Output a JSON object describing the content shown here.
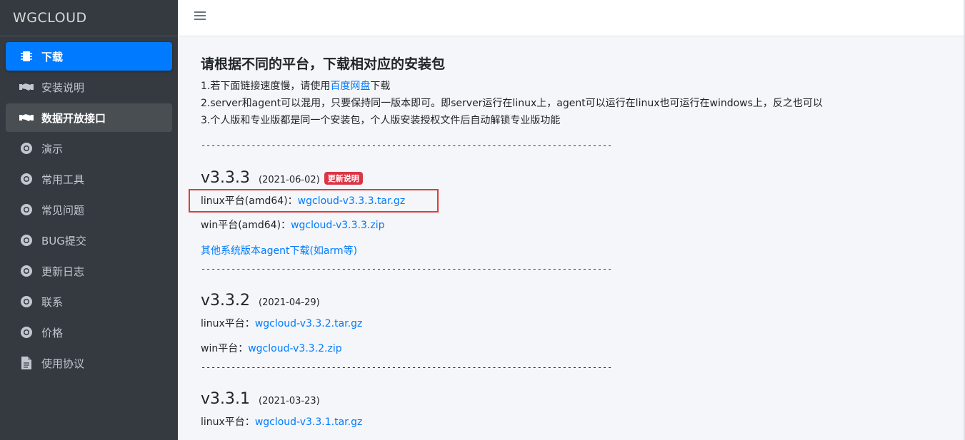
{
  "brand": "WGCLOUD",
  "sidebar": {
    "items": [
      {
        "label": "下载",
        "icon": "microchip-icon"
      },
      {
        "label": "安装说明",
        "icon": "handshake-icon"
      },
      {
        "label": "数据开放接口",
        "icon": "handshake-icon"
      },
      {
        "label": "演示",
        "icon": "chrome-icon"
      },
      {
        "label": "常用工具",
        "icon": "chrome-icon"
      },
      {
        "label": "常见问题",
        "icon": "chrome-icon"
      },
      {
        "label": "BUG提交",
        "icon": "chrome-icon"
      },
      {
        "label": "更新日志",
        "icon": "chrome-icon"
      },
      {
        "label": "联系",
        "icon": "chrome-icon"
      },
      {
        "label": "价格",
        "icon": "chrome-icon"
      },
      {
        "label": "使用协议",
        "icon": "file-icon"
      }
    ]
  },
  "topbar": {
    "menu_icon": "hamburger-icon"
  },
  "content": {
    "title": "请根据不同的平台，下载相对应的安装包",
    "note1_prefix": "1.若下面链接速度慢，请使用",
    "note1_link": "百度网盘",
    "note1_suffix": "下载",
    "note2": "2.server和agent可以混用，只要保持同一版本即可。即server运行在linux上，agent可以运行在linux也可运行在windows上，反之也可以",
    "note3": "3.个人版和专业版都是同一个安装包，个人版安装授权文件后自动解锁专业版功能",
    "separator": "------------------------------------------------------------------------------------------------------------------------------------------------------",
    "releases": [
      {
        "version": "v3.3.3",
        "date": "(2021-06-02)",
        "badge": "更新说明",
        "linux_label": "linux平台(amd64)：",
        "linux_file": "wgcloud-v3.3.3.tar.gz",
        "win_label": "win平台(amd64)：",
        "win_file": "wgcloud-v3.3.3.zip",
        "other_link": "其他系统版本agent下载(如arm等)"
      },
      {
        "version": "v3.3.2",
        "date": "(2021-04-29)",
        "linux_label": "linux平台：",
        "linux_file": "wgcloud-v3.3.2.tar.gz",
        "win_label": "win平台：",
        "win_file": "wgcloud-v3.3.2.zip"
      },
      {
        "version": "v3.3.1",
        "date": "(2021-03-23)",
        "linux_label": "linux平台：",
        "linux_file": "wgcloud-v3.3.1.tar.gz"
      }
    ]
  },
  "colors": {
    "sidebar_bg": "#343a40",
    "active": "#007bff",
    "link": "#007bff",
    "badge": "#dc3545",
    "highlight_box": "#e53935"
  }
}
